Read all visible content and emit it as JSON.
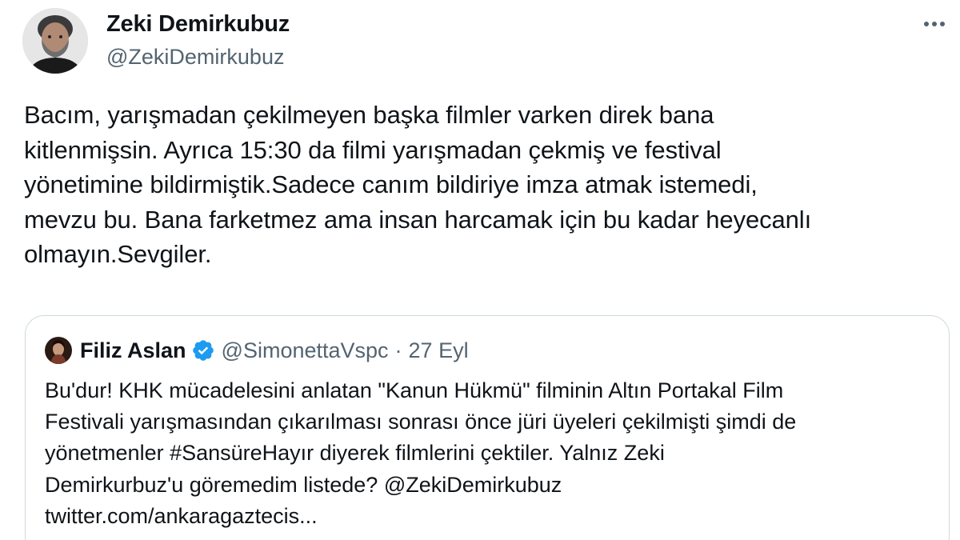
{
  "author": {
    "display_name": "Zeki Demirkubuz",
    "handle": "@ZekiDemirkubuz"
  },
  "tweet": {
    "text_lines": [
      "Bacım, yarışmadan çekilmeyen başka filmler varken direk bana",
      "kitlenmişsin. Ayrıca 15:30 da filmi yarışmadan çekmiş ve festival",
      "yönetimine bildirmiştik.Sadece canım bildiriye imza atmak istemedi,",
      "mevzu bu. Bana farketmez ama insan harcamak için bu kadar heyecanlı",
      "olmayın.Sevgiler."
    ]
  },
  "quoted": {
    "display_name": "Filiz Aslan",
    "handle": "@SimonettaVspc",
    "separator": "·",
    "date": "27 Eyl",
    "verified_color": "#1d9bf0",
    "text_lines": [
      "Bu'dur! KHK mücadelesini anlatan \"Kanun Hükmü\" filminin Altın Portakal Film",
      "Festivali yarışmasından çıkarılması sonrası önce jüri üyeleri çekilmişti şimdi de",
      "yönetmenler #SansüreHayır diyerek filmlerini çektiler. Yalnız Zeki",
      "Demirkurbuz'u göremedim listede? @ZekiDemirkubuz",
      "twitter.com/ankaragaztecis..."
    ]
  },
  "icons": {
    "more": "more-horizontal-icon",
    "verified": "verified-badge-icon"
  }
}
